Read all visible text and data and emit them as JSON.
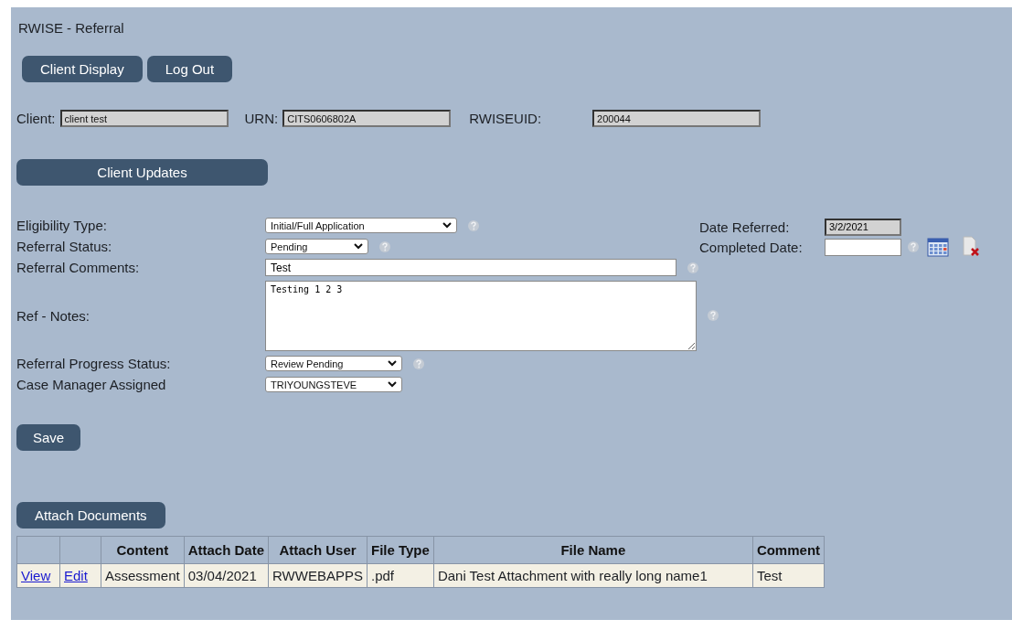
{
  "page_title": "RWISE - Referral",
  "nav_buttons": [
    "Client Display",
    "Log Out"
  ],
  "client_info": [
    {
      "label": "Client:",
      "value": "client test"
    },
    {
      "label": "URN:",
      "value": "CITS0606802A"
    },
    {
      "label": "RWISEUID:",
      "value": "200044"
    }
  ],
  "section_button": "Client Updates",
  "form_rows": [
    {
      "label": "Eligibility Type:",
      "kind": "select",
      "value": "Initial/Full Application",
      "help": true
    },
    {
      "label": "Referral Status:",
      "kind": "select",
      "value": "Pending",
      "help": true
    },
    {
      "label": "Referral Comments:",
      "kind": "text",
      "value": "Test",
      "help": true
    },
    {
      "label": "Ref - Notes:",
      "kind": "textarea",
      "value": "Testing 1 2 3",
      "help": true
    },
    {
      "label": "Referral Progress Status:",
      "kind": "select",
      "value": "Review Pending",
      "help": true
    },
    {
      "label": "Case Manager Assigned",
      "kind": "select",
      "value": "TRIYOUNGSTEVE",
      "help": false
    }
  ],
  "date_fields": [
    {
      "label": "Date Referred:",
      "value": "3/2/2021",
      "readonly": true,
      "tools": false
    },
    {
      "label": "Completed Date:",
      "readonly": false,
      "tools": true
    }
  ],
  "save_button": "Save",
  "attach_button": "Attach Documents",
  "table": {
    "columns": [
      "",
      "",
      "Content",
      "Attach Date",
      "Attach User",
      "File Type",
      "File Name",
      "Comment"
    ],
    "rows": [
      {
        "view": "View",
        "edit": "Edit",
        "content": "Assessment",
        "attach_date": "03/04/2021",
        "attach_user": "RWWEBAPPS",
        "file_type": ".pdf",
        "file_name": "Dani Test Attachment with really long name1",
        "comment": "Test"
      }
    ]
  }
}
